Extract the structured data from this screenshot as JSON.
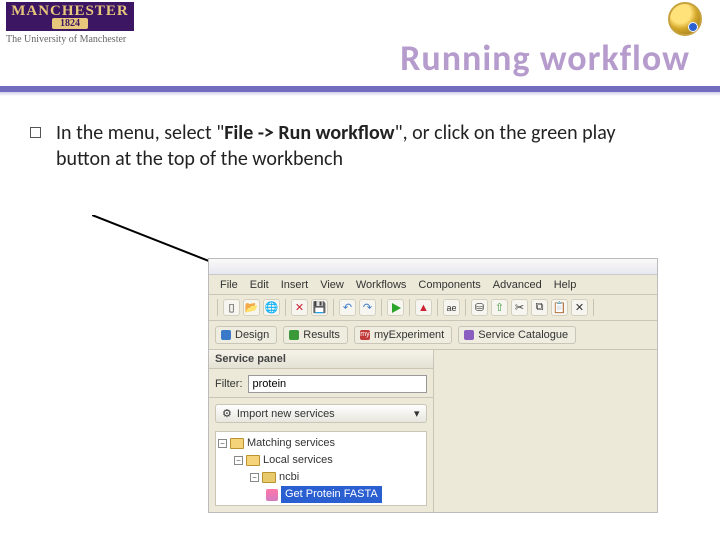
{
  "slide": {
    "logo_main": "MANCHESTER",
    "logo_year": "1824",
    "logo_sub": "The University of Manchester",
    "title": "Running workflow",
    "bullet_pre": "In the menu, select \"",
    "bullet_bold": "File -> Run workflow",
    "bullet_post": "\", or click on the green play button at the top of the workbench"
  },
  "menus": [
    "File",
    "Edit",
    "Insert",
    "View",
    "Workflows",
    "Components",
    "Advanced",
    "Help"
  ],
  "toolbar_icons": [
    {
      "name": "new-icon",
      "glyph": "▯",
      "color": "#d9a53a"
    },
    {
      "name": "open-icon",
      "glyph": "📂",
      "color": "#d9a53a"
    },
    {
      "name": "open-url-icon",
      "glyph": "🌐",
      "color": "#3a7ac9"
    },
    {
      "name": "close-icon",
      "glyph": "✕",
      "color": "#c23"
    },
    {
      "name": "save-icon",
      "glyph": "💾",
      "color": "#3a3ac9"
    },
    {
      "name": "undo-icon",
      "glyph": "↶",
      "color": "#3a7ac9"
    },
    {
      "name": "redo-icon",
      "glyph": "↷",
      "color": "#3a7ac9"
    }
  ],
  "toolbar_icons2": [
    {
      "name": "validate-icon",
      "glyph": "▲",
      "color": "#c23"
    },
    {
      "name": "ae-icon",
      "glyph": "ae",
      "color": "#555"
    }
  ],
  "toolbar_icons3": [
    {
      "name": "db-icon",
      "glyph": "⛁",
      "color": "#888"
    },
    {
      "name": "upload-icon",
      "glyph": "⇧",
      "color": "#3a9a3a"
    },
    {
      "name": "cut-icon",
      "glyph": "✂",
      "color": "#777"
    },
    {
      "name": "copy-icon",
      "glyph": "⧉",
      "color": "#777"
    },
    {
      "name": "paste-icon",
      "glyph": "📋",
      "color": "#a57a3a"
    },
    {
      "name": "delete-icon",
      "glyph": "✕",
      "color": "#888"
    }
  ],
  "perspectives": [
    {
      "name": "design",
      "label": "Design",
      "color": "#3a7ac9"
    },
    {
      "name": "results",
      "label": "Results",
      "color": "#3a9a3a"
    },
    {
      "name": "myexperiment",
      "label": "myExperiment",
      "color": "#c23a3a",
      "prefix": "my"
    },
    {
      "name": "service-catalogue",
      "label": "Service Catalogue",
      "color": "#8a5fc0"
    }
  ],
  "panel": {
    "title": "Service panel",
    "filter_label": "Filter:",
    "filter_value": "protein",
    "import_label": "Import new services"
  },
  "tree": {
    "matching": "Matching services",
    "local": "Local services",
    "ncbi": "ncbi",
    "selected": "Get Protein FASTA"
  }
}
